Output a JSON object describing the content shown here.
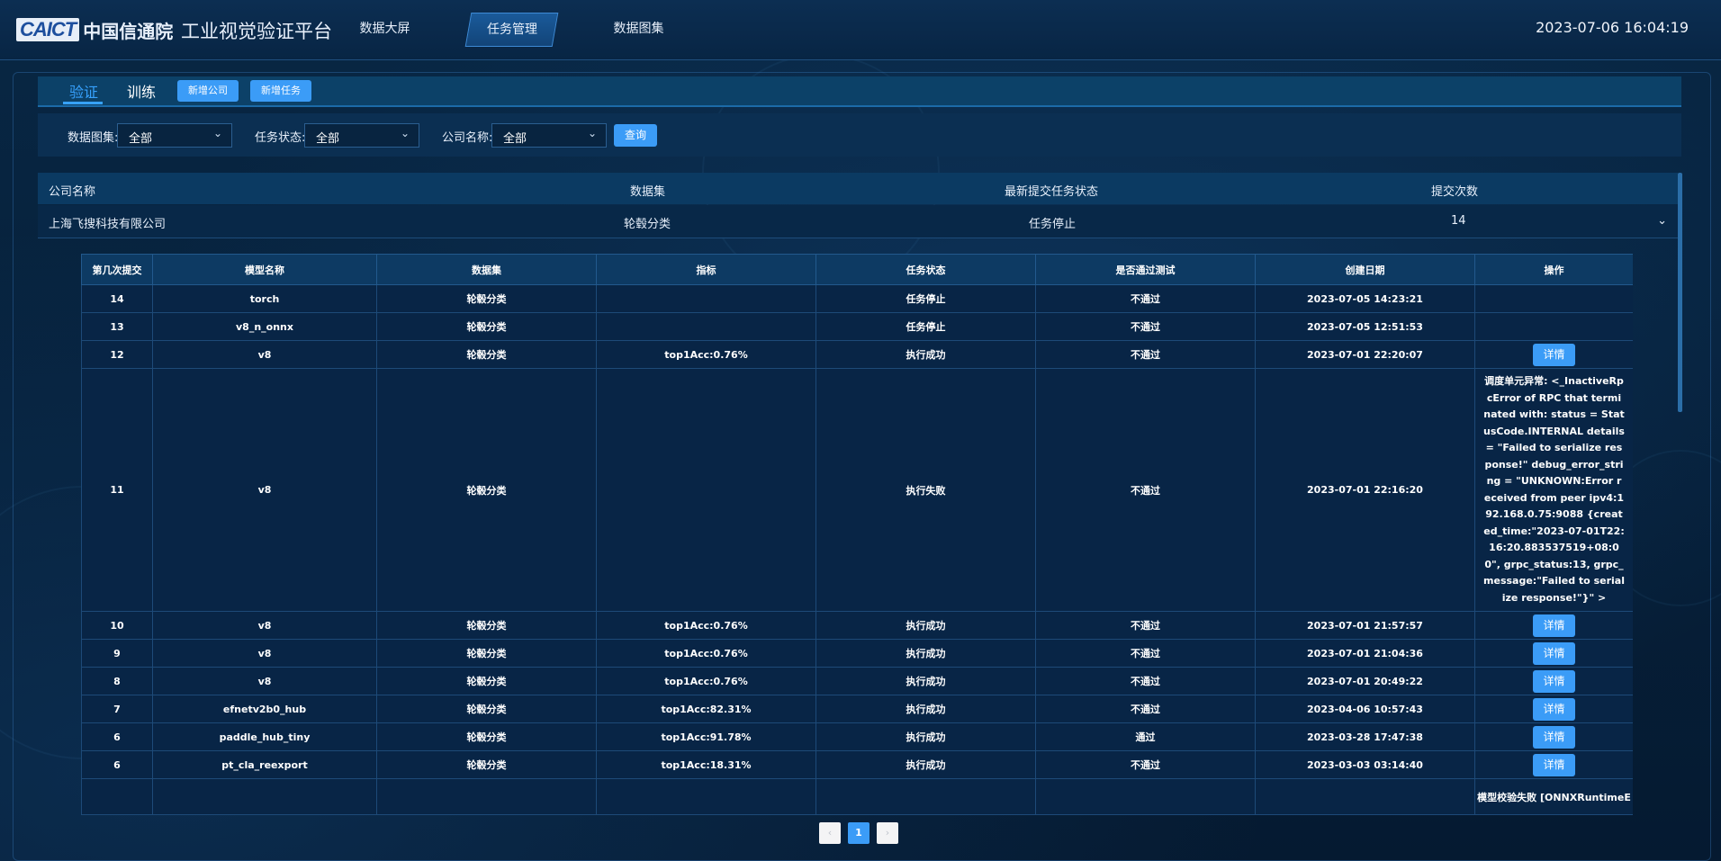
{
  "header": {
    "logo_mark": "CAICT",
    "logo_cn": "中国信通院",
    "platform_title": "工业视觉验证平台",
    "nav": [
      {
        "label": "数据大屏",
        "active": false
      },
      {
        "label": "任务管理",
        "active": true
      },
      {
        "label": "数据图集",
        "active": false
      }
    ],
    "datetime": "2023-07-06 16:04:19"
  },
  "tabs": {
    "verify": "验证",
    "train": "训练",
    "add_company": "新增公司",
    "add_task": "新增任务"
  },
  "filters": {
    "dataset_label": "数据图集:",
    "dataset_value": "全部",
    "status_label": "任务状态:",
    "status_value": "全部",
    "company_label": "公司名称:",
    "company_value": "全部",
    "query_label": "查询"
  },
  "outer_table": {
    "headers": [
      "公司名称",
      "数据集",
      "最新提交任务状态",
      "提交次数"
    ],
    "row": {
      "company": "上海飞搜科技有限公司",
      "dataset": "轮毂分类",
      "status": "任务停止",
      "count": "14"
    }
  },
  "inner_table": {
    "headers": [
      "第几次提交",
      "模型名称",
      "数据集",
      "指标",
      "任务状态",
      "是否通过测试",
      "创建日期",
      "操作"
    ],
    "detail_label": "详情",
    "rows": [
      {
        "n": "14",
        "model": "torch",
        "dataset": "轮毂分类",
        "metric": "",
        "status": "任务停止",
        "pass": "不通过",
        "date": "2023-07-05 14:23:21",
        "op": ""
      },
      {
        "n": "13",
        "model": "v8_n_onnx",
        "dataset": "轮毂分类",
        "metric": "",
        "status": "任务停止",
        "pass": "不通过",
        "date": "2023-07-05 12:51:53",
        "op": ""
      },
      {
        "n": "12",
        "model": "v8",
        "dataset": "轮毂分类",
        "metric": "top1Acc:0.76%",
        "status": "执行成功",
        "pass": "不通过",
        "date": "2023-07-01 22:20:07",
        "op": "detail"
      },
      {
        "n": "11",
        "model": "v8",
        "dataset": "轮毂分类",
        "metric": "",
        "status": "执行失败",
        "pass": "不通过",
        "date": "2023-07-01 22:16:20",
        "op": "error",
        "error": "调度单元异常: <_InactiveRpcError of RPC that terminated with: status = StatusCode.INTERNAL details = \"Failed to serialize response!\" debug_error_string = \"UNKNOWN:Error received from peer ipv4:192.168.0.75:9088 {created_time:\"2023-07-01T22:16:20.883537519+08:00\", grpc_status:13, grpc_message:\"Failed to serialize response!\"}\" >"
      },
      {
        "n": "10",
        "model": "v8",
        "dataset": "轮毂分类",
        "metric": "top1Acc:0.76%",
        "status": "执行成功",
        "pass": "不通过",
        "date": "2023-07-01 21:57:57",
        "op": "detail"
      },
      {
        "n": "9",
        "model": "v8",
        "dataset": "轮毂分类",
        "metric": "top1Acc:0.76%",
        "status": "执行成功",
        "pass": "不通过",
        "date": "2023-07-01 21:04:36",
        "op": "detail"
      },
      {
        "n": "8",
        "model": "v8",
        "dataset": "轮毂分类",
        "metric": "top1Acc:0.76%",
        "status": "执行成功",
        "pass": "不通过",
        "date": "2023-07-01 20:49:22",
        "op": "detail"
      },
      {
        "n": "7",
        "model": "efnetv2b0_hub",
        "dataset": "轮毂分类",
        "metric": "top1Acc:82.31%",
        "status": "执行成功",
        "pass": "不通过",
        "date": "2023-04-06 10:57:43",
        "op": "detail"
      },
      {
        "n": "6",
        "model": "paddle_hub_tiny",
        "dataset": "轮毂分类",
        "metric": "top1Acc:91.78%",
        "status": "执行成功",
        "pass": "通过",
        "date": "2023-03-28 17:47:38",
        "op": "detail"
      },
      {
        "n": "6",
        "model": "pt_cla_reexport",
        "dataset": "轮毂分类",
        "metric": "top1Acc:18.31%",
        "status": "执行成功",
        "pass": "不通过",
        "date": "2023-03-03 03:14:40",
        "op": "detail"
      },
      {
        "n": "",
        "model": "",
        "dataset": "",
        "metric": "",
        "status": "",
        "pass": "",
        "date": "",
        "op": "error-clip",
        "error": "模型校验失败 [ONNXRuntimeE"
      }
    ]
  },
  "pagination": {
    "prev": "‹",
    "current": "1",
    "next": "›"
  },
  "colors": {
    "accent": "#3b9cf7",
    "bg": "#06203c",
    "active_tab": "#37a2ff"
  }
}
